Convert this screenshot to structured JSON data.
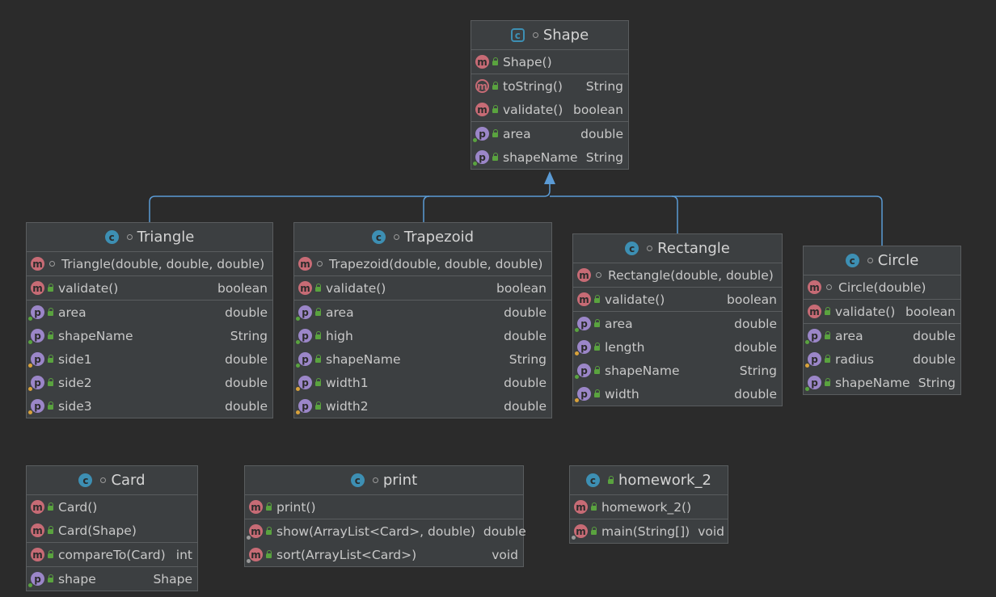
{
  "colors": {
    "background": "#2b2b2b",
    "box": "#3c3f41",
    "border": "#5a5d5f",
    "arrow": "#5b9bd5",
    "method_icon": "#c76b75",
    "property_icon": "#9b86c8",
    "class_icon": "#3d8fb3",
    "public_lock": "#5aa33f"
  },
  "classes": {
    "shape": {
      "name": "Shape",
      "methods_ctor": [
        {
          "name": "Shape()",
          "type": ""
        }
      ],
      "methods": [
        {
          "name": "toString()",
          "type": "String"
        },
        {
          "name": "validate()",
          "type": "boolean"
        }
      ],
      "props": [
        {
          "name": "area",
          "type": "double"
        },
        {
          "name": "shapeName",
          "type": "String"
        }
      ]
    },
    "triangle": {
      "name": "Triangle",
      "methods_ctor": [
        {
          "name": "Triangle(double, double, double)",
          "type": ""
        }
      ],
      "methods": [
        {
          "name": "validate()",
          "type": "boolean"
        }
      ],
      "props": [
        {
          "name": "area",
          "type": "double"
        },
        {
          "name": "shapeName",
          "type": "String"
        },
        {
          "name": "side1",
          "type": "double"
        },
        {
          "name": "side2",
          "type": "double"
        },
        {
          "name": "side3",
          "type": "double"
        }
      ]
    },
    "trapezoid": {
      "name": "Trapezoid",
      "methods_ctor": [
        {
          "name": "Trapezoid(double, double, double)",
          "type": ""
        }
      ],
      "methods": [
        {
          "name": "validate()",
          "type": "boolean"
        }
      ],
      "props": [
        {
          "name": "area",
          "type": "double"
        },
        {
          "name": "high",
          "type": "double"
        },
        {
          "name": "shapeName",
          "type": "String"
        },
        {
          "name": "width1",
          "type": "double"
        },
        {
          "name": "width2",
          "type": "double"
        }
      ]
    },
    "rectangle": {
      "name": "Rectangle",
      "methods_ctor": [
        {
          "name": "Rectangle(double, double)",
          "type": ""
        }
      ],
      "methods": [
        {
          "name": "validate()",
          "type": "boolean"
        }
      ],
      "props": [
        {
          "name": "area",
          "type": "double"
        },
        {
          "name": "length",
          "type": "double"
        },
        {
          "name": "shapeName",
          "type": "String"
        },
        {
          "name": "width",
          "type": "double"
        }
      ]
    },
    "circle": {
      "name": "Circle",
      "methods_ctor": [
        {
          "name": "Circle(double)",
          "type": ""
        }
      ],
      "methods": [
        {
          "name": "validate()",
          "type": "boolean"
        }
      ],
      "props": [
        {
          "name": "area",
          "type": "double"
        },
        {
          "name": "radius",
          "type": "double"
        },
        {
          "name": "shapeName",
          "type": "String"
        }
      ]
    },
    "card": {
      "name": "Card",
      "methods_ctor": [
        {
          "name": "Card()",
          "type": ""
        },
        {
          "name": "Card(Shape)",
          "type": ""
        }
      ],
      "methods": [
        {
          "name": "compareTo(Card)",
          "type": "int"
        }
      ],
      "props": [
        {
          "name": "shape",
          "type": "Shape"
        }
      ]
    },
    "print": {
      "name": "print",
      "methods_ctor": [
        {
          "name": "print()",
          "type": ""
        }
      ],
      "methods": [
        {
          "name": "show(ArrayList<Card>, double)",
          "type": "double"
        },
        {
          "name": "sort(ArrayList<Card>)",
          "type": "void"
        }
      ],
      "props": []
    },
    "homework": {
      "name": "homework_2",
      "methods_ctor": [
        {
          "name": "homework_2()",
          "type": ""
        }
      ],
      "methods": [
        {
          "name": "main(String[])",
          "type": "void"
        }
      ],
      "props": []
    }
  }
}
